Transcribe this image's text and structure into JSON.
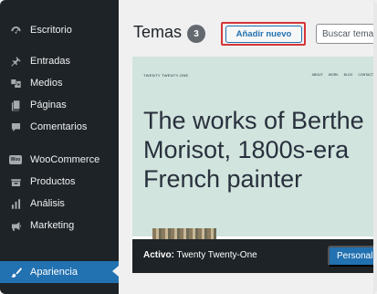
{
  "sidebar": {
    "items": [
      {
        "label": "Escritorio",
        "icon": "dashboard-icon"
      },
      {
        "label": "Entradas",
        "icon": "pin-icon"
      },
      {
        "label": "Medios",
        "icon": "media-icon"
      },
      {
        "label": "Páginas",
        "icon": "pages-icon"
      },
      {
        "label": "Comentarios",
        "icon": "comments-icon"
      },
      {
        "label": "WooCommerce",
        "icon": "woocommerce-icon",
        "badge": "woo"
      },
      {
        "label": "Productos",
        "icon": "products-icon"
      },
      {
        "label": "Análisis",
        "icon": "analytics-icon"
      },
      {
        "label": "Marketing",
        "icon": "megaphone-icon"
      },
      {
        "label": "Apariencia",
        "icon": "brush-icon",
        "active": true
      }
    ]
  },
  "header": {
    "title": "Temas",
    "count": "3",
    "add_new_label": "Añadir nuevo",
    "search_placeholder": "Buscar temas..."
  },
  "theme": {
    "site_title": "TWENTY TWENTY-ONE",
    "nav": [
      "ABOUT",
      "WORK",
      "BLOG",
      "CONTACT"
    ],
    "heading": "The works of Berthe Morisot, 1800s-era French painter",
    "active_prefix": "Activo:",
    "active_name": "Twenty Twenty-One",
    "customize_label": "Personalizar"
  },
  "colors": {
    "sidebar_bg": "#1d2327",
    "accent": "#2271b1",
    "highlight_outline": "#d63638",
    "theme_preview_bg": "#d1e4dd"
  }
}
